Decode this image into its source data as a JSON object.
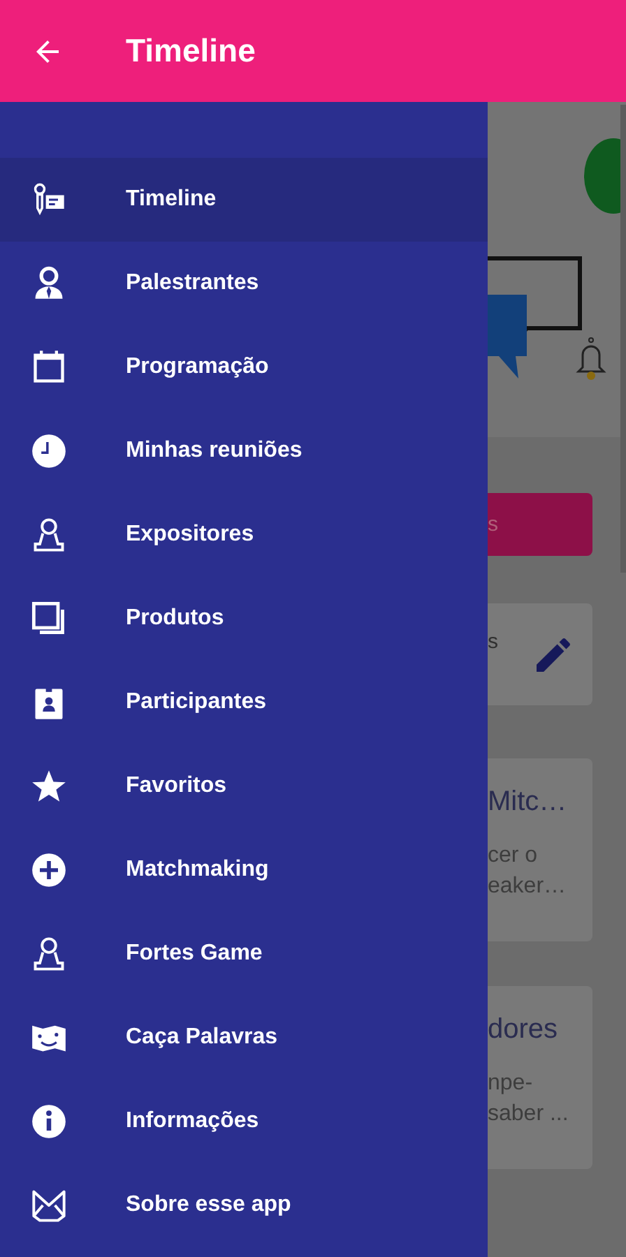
{
  "app_bar": {
    "title": "Timeline"
  },
  "drawer": {
    "items": [
      {
        "label": "Timeline",
        "kind": "microphone",
        "selected": true
      },
      {
        "label": "Palestrantes",
        "kind": "speaker",
        "selected": false
      },
      {
        "label": "Programação",
        "kind": "calendar",
        "selected": false
      },
      {
        "label": "Minhas reuniões",
        "kind": "clock",
        "selected": false
      },
      {
        "label": "Expositores",
        "kind": "person",
        "selected": false
      },
      {
        "label": "Produtos",
        "kind": "stack",
        "selected": false
      },
      {
        "label": "Participantes",
        "kind": "badge",
        "selected": false
      },
      {
        "label": "Favoritos",
        "kind": "star",
        "selected": false
      },
      {
        "label": "Matchmaking",
        "kind": "plus",
        "selected": false
      },
      {
        "label": "Fortes Game",
        "kind": "person",
        "selected": false
      },
      {
        "label": "Caça Palavras",
        "kind": "map",
        "selected": false
      },
      {
        "label": "Informações",
        "kind": "info",
        "selected": false
      },
      {
        "label": "Sobre esse app",
        "kind": "envelope",
        "selected": false
      }
    ]
  },
  "background": {
    "button_label": "s",
    "field_hint": "s",
    "cards": [
      {
        "title": "Mitc…",
        "lines": [
          "cer o",
          "eaker…"
        ]
      },
      {
        "title": "dores",
        "lines": [
          "npe-",
          "saber ..."
        ]
      }
    ]
  }
}
